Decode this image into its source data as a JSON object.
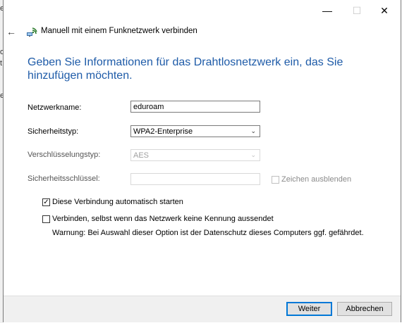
{
  "background_fragments": [
    "e",
    "o",
    "t",
    "e"
  ],
  "window": {
    "minimize_glyph": "—",
    "maximize_glyph": "☐",
    "close_glyph": "✕"
  },
  "nav": {
    "back_glyph": "←"
  },
  "dialog_title": "Manuell mit einem Funknetzwerk verbinden",
  "heading": "Geben Sie Informationen für das Drahtlosnetzwerk ein, das Sie hinzufügen möchten.",
  "form": {
    "network_name_label": "Netzwerkname:",
    "network_name_value": "eduroam",
    "security_type_label": "Sicherheitstyp:",
    "security_type_value": "WPA2-Enterprise",
    "encryption_type_label": "Verschlüsselungstyp:",
    "encryption_type_value": "AES",
    "security_key_label": "Sicherheitsschlüssel:",
    "security_key_value": "",
    "hide_chars_label": "Zeichen ausblenden",
    "auto_start_label": "Diese Verbindung automatisch starten",
    "auto_start_checked": true,
    "connect_hidden_label": "Verbinden, selbst wenn das Netzwerk keine Kennung aussendet",
    "connect_hidden_checked": false,
    "warning_text": "Warnung: Bei Auswahl dieser Option ist der Datenschutz dieses Computers ggf. gefährdet."
  },
  "buttons": {
    "next_label": "Weiter",
    "cancel_label": "Abbrechen"
  },
  "colors": {
    "heading": "#1e5ba8",
    "primary_border": "#0078d7"
  },
  "icons": {
    "dialog": "wifi-network-icon",
    "back": "back-arrow-icon",
    "dropdown": "chevron-down-icon"
  }
}
